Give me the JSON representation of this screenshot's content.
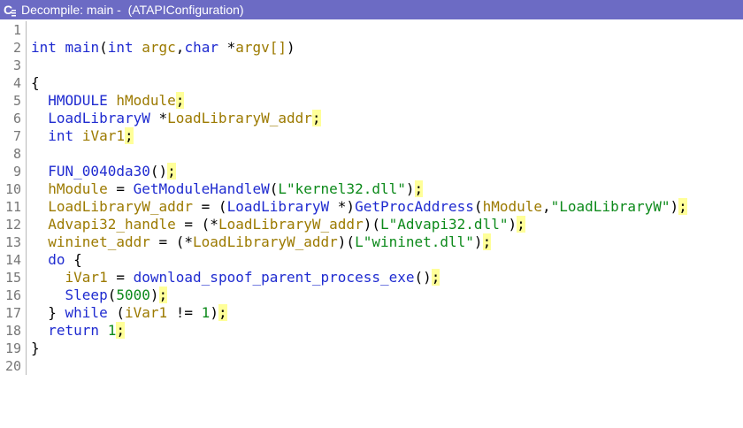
{
  "window": {
    "title": "Decompile: main -  (ATAPIConfiguration)",
    "icon": "decompiler-icon",
    "colors": {
      "titlebar": "#6c6bc4"
    }
  },
  "line_numbers": [
    "1",
    "2",
    "3",
    "4",
    "5",
    "6",
    "7",
    "8",
    "9",
    "10",
    "11",
    "12",
    "13",
    "14",
    "15",
    "16",
    "17",
    "18",
    "19",
    "20"
  ],
  "code": {
    "l2": {
      "t1": "int",
      "t2": "main",
      "t3": "(",
      "t4": "int",
      "t5": " ",
      "t6": "argc",
      "t7": ",",
      "t8": "char",
      "t9": " *",
      "t10": "argv",
      "t11": "[]",
      "t12": ")"
    },
    "l4": {
      "t1": "{"
    },
    "l5": {
      "t1": "HMODULE",
      "t2": " ",
      "t3": "hModule",
      "t4": ";"
    },
    "l6": {
      "t1": "LoadLibraryW",
      "t2": " *",
      "t3": "LoadLibraryW_addr",
      "t4": ";"
    },
    "l7": {
      "t1": "int",
      "t2": " ",
      "t3": "iVar1",
      "t4": ";"
    },
    "l9": {
      "t1": "FUN_0040da30",
      "t2": "()",
      "t3": ";"
    },
    "l10": {
      "t1": "hModule",
      "t2": " = ",
      "t3": "GetModuleHandleW",
      "t4": "(",
      "t5": "L\"kernel32.dll\"",
      "t6": ")",
      "t7": ";"
    },
    "l11": {
      "t1": "LoadLibraryW_addr",
      "t2": " = (",
      "t3": "LoadLibraryW",
      "t4": " *)",
      "t5": "GetProcAddress",
      "t6": "(",
      "t7": "hModule",
      "t8": ",",
      "t9": "\"LoadLibraryW\"",
      "t10": ")",
      "t11": ";"
    },
    "l12": {
      "t1": "Advapi32_handle",
      "t2": " = (*",
      "t3": "LoadLibraryW_addr",
      "t4": ")(",
      "t5": "L\"Advapi32.dll\"",
      "t6": ")",
      "t7": ";"
    },
    "l13": {
      "t1": "wininet_addr",
      "t2": " = (*",
      "t3": "LoadLibraryW_addr",
      "t4": ")(",
      "t5": "L\"wininet.dll\"",
      "t6": ")",
      "t7": ";"
    },
    "l14": {
      "t1": "do",
      "t2": " {"
    },
    "l15": {
      "t1": "iVar1",
      "t2": " = ",
      "t3": "download_spoof_parent_process_exe",
      "t4": "()",
      "t5": ";"
    },
    "l16": {
      "t1": "Sleep",
      "t2": "(",
      "t3": "5000",
      "t4": ")",
      "t5": ";"
    },
    "l17": {
      "t1": "} ",
      "t2": "while",
      "t3": " (",
      "t4": "iVar1",
      "t5": " != ",
      "t6": "1",
      "t7": ")",
      "t8": ";"
    },
    "l18": {
      "t1": "return",
      "t2": " ",
      "t3": "1",
      "t4": ";"
    },
    "l19": {
      "t1": "}"
    }
  }
}
